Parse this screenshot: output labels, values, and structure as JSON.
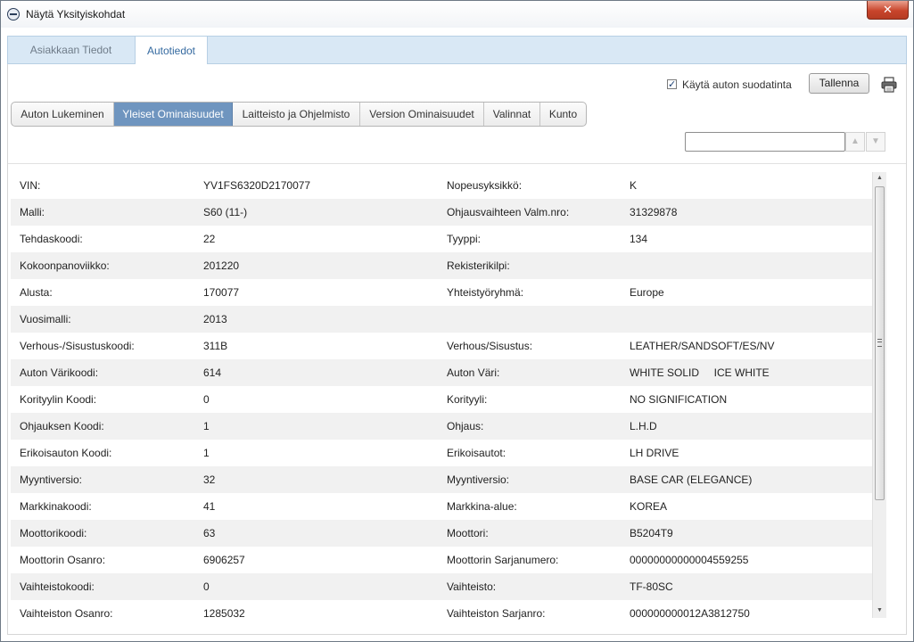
{
  "window": {
    "title": "Näytä Yksityiskohdat",
    "close_glyph": "✕"
  },
  "outer_tabs": [
    {
      "label": "Asiakkaan Tiedot",
      "active": false
    },
    {
      "label": "Autotiedot",
      "active": true
    }
  ],
  "toolbar": {
    "filter_label": "Käytä auton suodatinta",
    "filter_checked": true,
    "check_glyph": "✓",
    "save_label": "Tallenna",
    "print_icon": "printer-icon"
  },
  "sub_tabs": [
    {
      "label": "Auton Lukeminen",
      "active": false
    },
    {
      "label": "Yleiset Ominaisuudet",
      "active": true
    },
    {
      "label": "Laitteisto ja Ohjelmisto",
      "active": false
    },
    {
      "label": "Version Ominaisuudet",
      "active": false
    },
    {
      "label": "Valinnat",
      "active": false
    },
    {
      "label": "Kunto",
      "active": false
    }
  ],
  "search": {
    "value": "",
    "prev_glyph": "▲",
    "next_glyph": "▼"
  },
  "details": [
    {
      "label1": "VIN:",
      "value1": "YV1FS6320D2170077",
      "label2": "Nopeusyksikkö:",
      "value2": "K"
    },
    {
      "label1": "Malli:",
      "value1": "S60 (11-)",
      "label2": "Ohjausvaihteen Valm.nro:",
      "value2": "31329878"
    },
    {
      "label1": "Tehdaskoodi:",
      "value1": "22",
      "label2": "Tyyppi:",
      "value2": "134"
    },
    {
      "label1": "Kokoonpanoviikko:",
      "value1": "201220",
      "label2": "Rekisterikilpi:",
      "value2": ""
    },
    {
      "label1": "Alusta:",
      "value1": "170077",
      "label2": "Yhteistyöryhmä:",
      "value2": "Europe"
    },
    {
      "label1": "Vuosimalli:",
      "value1": "2013",
      "label2": "",
      "value2": ""
    },
    {
      "label1": "Verhous-/Sisustuskoodi:",
      "value1": "311B",
      "label2": "Verhous/Sisustus:",
      "value2": "LEATHER/SANDSOFT/ES/NV"
    },
    {
      "label1": "Auton Värikoodi:",
      "value1": "614",
      "label2": "Auton Väri:",
      "value2": "WHITE SOLID     ICE WHITE"
    },
    {
      "label1": "Korityylin Koodi:",
      "value1": "0",
      "label2": "Korityyli:",
      "value2": "NO SIGNIFICATION"
    },
    {
      "label1": "Ohjauksen Koodi:",
      "value1": "1",
      "label2": "Ohjaus:",
      "value2": "L.H.D"
    },
    {
      "label1": "Erikoisauton Koodi:",
      "value1": "1",
      "label2": "Erikoisautot:",
      "value2": "LH DRIVE"
    },
    {
      "label1": "Myyntiversio:",
      "value1": "32",
      "label2": "Myyntiversio:",
      "value2": "BASE CAR (ELEGANCE)"
    },
    {
      "label1": "Markkinakoodi:",
      "value1": "41",
      "label2": "Markkina-alue:",
      "value2": "KOREA"
    },
    {
      "label1": "Moottorikoodi:",
      "value1": "63",
      "label2": "Moottori:",
      "value2": "B5204T9"
    },
    {
      "label1": "Moottorin Osanro:",
      "value1": "6906257",
      "label2": "Moottorin Sarjanumero:",
      "value2": "00000000000004559255"
    },
    {
      "label1": "Vaihteistokoodi:",
      "value1": "0",
      "label2": "Vaihteisto:",
      "value2": "TF-80SC"
    },
    {
      "label1": "Vaihteiston Osanro:",
      "value1": "1285032",
      "label2": "Vaihteiston Sarjanro:",
      "value2": "000000000012A3812750"
    }
  ],
  "scrollbar": {
    "up_glyph": "▲",
    "down_glyph": "▼"
  }
}
